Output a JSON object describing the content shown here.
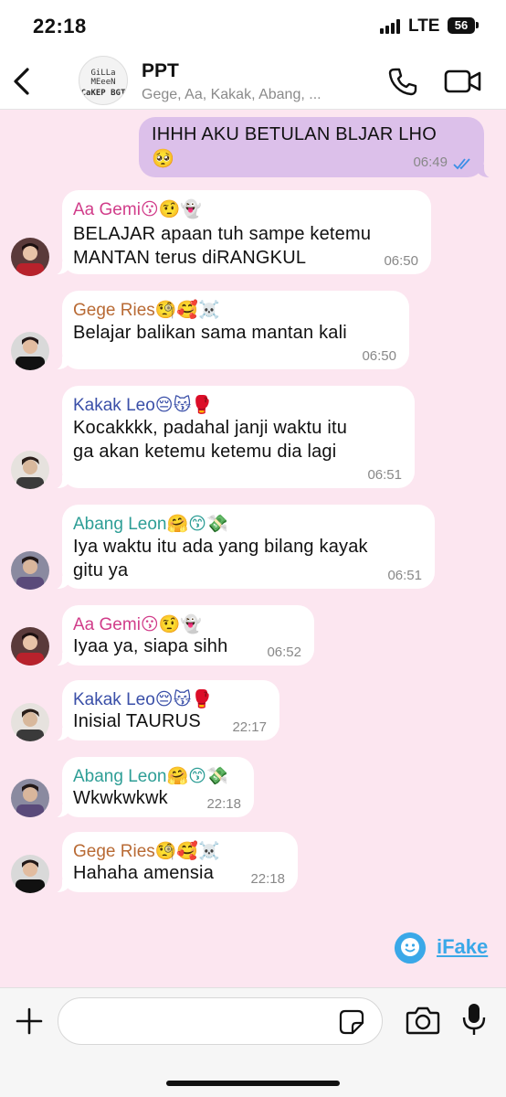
{
  "status_bar": {
    "time": "22:18",
    "network": "LTE",
    "battery": "56"
  },
  "header": {
    "title": "PPT",
    "subtitle": "Gege, Aa, Kakak, Abang, ...",
    "avatar_line1": "GiLLa MEeeN",
    "avatar_line2": "CaKEP BGT"
  },
  "messages": [
    {
      "text": "IHHH AKU BETULAN BLJAR LHO",
      "emoji": "🥺",
      "time": "06:49"
    },
    {
      "sender": "Aa Gemi😗🤨👻",
      "lines": [
        "BELAJAR apaan tuh sampe ketemu",
        "MANTAN terus diRANGKUL"
      ],
      "time": "06:50"
    },
    {
      "sender": "Gege Ries🧐🥰☠️",
      "lines": [
        "Belajar balikan sama mantan kali"
      ],
      "time": "06:50"
    },
    {
      "sender": "Kakak Leo😔😽🥊",
      "lines": [
        "Kocakkkk, padahal janji waktu itu",
        "ga akan ketemu ketemu dia lagi"
      ],
      "time": "06:51"
    },
    {
      "sender": "Abang Leon🤗😙💸",
      "lines": [
        "Iya waktu itu ada yang bilang kayak",
        "gitu ya"
      ],
      "time": "06:51"
    },
    {
      "sender": "Aa Gemi😗🤨👻",
      "lines": [
        "Iyaa ya, siapa sihh"
      ],
      "time": "06:52"
    },
    {
      "sender": "Kakak Leo😔😽🥊",
      "lines": [
        "Inisial TAURUS"
      ],
      "time": "22:17"
    },
    {
      "sender": "Abang Leon🤗😙💸",
      "lines": [
        "Wkwkwkwk"
      ],
      "time": "22:18"
    },
    {
      "sender": "Gege Ries🧐🥰☠️",
      "lines": [
        "Hahaha amensia"
      ],
      "time": "22:18"
    }
  ],
  "colors": {
    "Aa Gemi": "#d13d8a",
    "Gege Ries": "#b86a34",
    "Kakak Leo": "#3a4fa8",
    "Abang Leon": "#2e9e96",
    "background": "#fce6f0",
    "outgoing": "#dcc0ea",
    "read_ticks": "#3a8ee6"
  },
  "watermark": {
    "text": "iFake"
  },
  "input": {
    "placeholder": ""
  },
  "icons": [
    "back-arrow-icon",
    "phone-icon",
    "video-icon",
    "plus-icon",
    "sticker-icon",
    "camera-icon",
    "microphone-icon",
    "double-check-icon",
    "ifake-logo-icon"
  ]
}
